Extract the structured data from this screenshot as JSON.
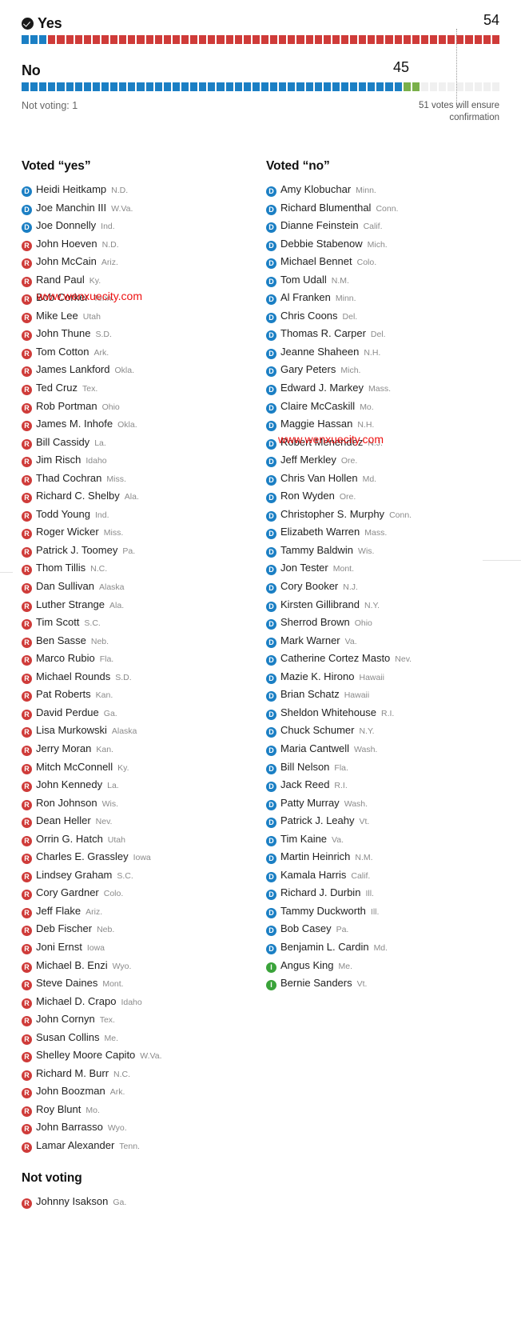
{
  "summary": {
    "yes": {
      "label": "Yes",
      "count": "54",
      "icon": "check-circle-icon",
      "blocks": [
        {
          "party": "D",
          "n": 3
        },
        {
          "party": "R",
          "n": 51
        }
      ]
    },
    "no": {
      "label": "No",
      "count": "45",
      "blocks": [
        {
          "party": "D",
          "n": 43
        },
        {
          "party": "I",
          "n": 2
        },
        {
          "party": "empty",
          "n": 9
        }
      ]
    },
    "not_voting_line": "Not voting: 1",
    "threshold_note": "51 votes will ensure confirmation"
  },
  "colors": {
    "democrat": "#1b7fc4",
    "republican": "#cf3b39",
    "independent": "#7ab04a",
    "empty": "#f0f0f0"
  },
  "watermark": {
    "text": "www.wenxuecity.com"
  },
  "sections": {
    "yes_title": "Voted “yes”",
    "no_title": "Voted “no”",
    "not_voting_title": "Not voting"
  },
  "voted_yes": [
    {
      "party": "D",
      "name": "Heidi Heitkamp",
      "state": "N.D."
    },
    {
      "party": "D",
      "name": "Joe Manchin III",
      "state": "W.Va."
    },
    {
      "party": "D",
      "name": "Joe Donnelly",
      "state": "Ind."
    },
    {
      "party": "R",
      "name": "John Hoeven",
      "state": "N.D."
    },
    {
      "party": "R",
      "name": "John McCain",
      "state": "Ariz."
    },
    {
      "party": "R",
      "name": "Rand Paul",
      "state": "Ky."
    },
    {
      "party": "R",
      "name": "Bob Corker",
      "state": "Tenn."
    },
    {
      "party": "R",
      "name": "Mike Lee",
      "state": "Utah"
    },
    {
      "party": "R",
      "name": "John Thune",
      "state": "S.D."
    },
    {
      "party": "R",
      "name": "Tom Cotton",
      "state": "Ark."
    },
    {
      "party": "R",
      "name": "James Lankford",
      "state": "Okla."
    },
    {
      "party": "R",
      "name": "Ted Cruz",
      "state": "Tex."
    },
    {
      "party": "R",
      "name": "Rob Portman",
      "state": "Ohio"
    },
    {
      "party": "R",
      "name": "James M. Inhofe",
      "state": "Okla."
    },
    {
      "party": "R",
      "name": "Bill Cassidy",
      "state": "La."
    },
    {
      "party": "R",
      "name": "Jim Risch",
      "state": "Idaho"
    },
    {
      "party": "R",
      "name": "Thad Cochran",
      "state": "Miss."
    },
    {
      "party": "R",
      "name": "Richard C. Shelby",
      "state": "Ala."
    },
    {
      "party": "R",
      "name": "Todd Young",
      "state": "Ind."
    },
    {
      "party": "R",
      "name": "Roger Wicker",
      "state": "Miss."
    },
    {
      "party": "R",
      "name": "Patrick J. Toomey",
      "state": "Pa."
    },
    {
      "party": "R",
      "name": "Thom Tillis",
      "state": "N.C."
    },
    {
      "party": "R",
      "name": "Dan Sullivan",
      "state": "Alaska"
    },
    {
      "party": "R",
      "name": "Luther Strange",
      "state": "Ala."
    },
    {
      "party": "R",
      "name": "Tim Scott",
      "state": "S.C."
    },
    {
      "party": "R",
      "name": "Ben Sasse",
      "state": "Neb."
    },
    {
      "party": "R",
      "name": "Marco Rubio",
      "state": "Fla."
    },
    {
      "party": "R",
      "name": "Michael Rounds",
      "state": "S.D."
    },
    {
      "party": "R",
      "name": "Pat Roberts",
      "state": "Kan."
    },
    {
      "party": "R",
      "name": "David Perdue",
      "state": "Ga."
    },
    {
      "party": "R",
      "name": "Lisa Murkowski",
      "state": "Alaska"
    },
    {
      "party": "R",
      "name": "Jerry Moran",
      "state": "Kan."
    },
    {
      "party": "R",
      "name": "Mitch McConnell",
      "state": "Ky."
    },
    {
      "party": "R",
      "name": "John Kennedy",
      "state": "La."
    },
    {
      "party": "R",
      "name": "Ron Johnson",
      "state": "Wis."
    },
    {
      "party": "R",
      "name": "Dean Heller",
      "state": "Nev."
    },
    {
      "party": "R",
      "name": "Orrin G. Hatch",
      "state": "Utah"
    },
    {
      "party": "R",
      "name": "Charles E. Grassley",
      "state": "Iowa"
    },
    {
      "party": "R",
      "name": "Lindsey Graham",
      "state": "S.C."
    },
    {
      "party": "R",
      "name": "Cory Gardner",
      "state": "Colo."
    },
    {
      "party": "R",
      "name": "Jeff Flake",
      "state": "Ariz."
    },
    {
      "party": "R",
      "name": "Deb Fischer",
      "state": "Neb."
    },
    {
      "party": "R",
      "name": "Joni Ernst",
      "state": "Iowa"
    },
    {
      "party": "R",
      "name": "Michael B. Enzi",
      "state": "Wyo."
    },
    {
      "party": "R",
      "name": "Steve Daines",
      "state": "Mont."
    },
    {
      "party": "R",
      "name": "Michael D. Crapo",
      "state": "Idaho"
    },
    {
      "party": "R",
      "name": "John Cornyn",
      "state": "Tex."
    },
    {
      "party": "R",
      "name": "Susan Collins",
      "state": "Me."
    },
    {
      "party": "R",
      "name": "Shelley Moore Capito",
      "state": "W.Va."
    },
    {
      "party": "R",
      "name": "Richard M. Burr",
      "state": "N.C."
    },
    {
      "party": "R",
      "name": "John Boozman",
      "state": "Ark."
    },
    {
      "party": "R",
      "name": "Roy Blunt",
      "state": "Mo."
    },
    {
      "party": "R",
      "name": "John Barrasso",
      "state": "Wyo."
    },
    {
      "party": "R",
      "name": "Lamar Alexander",
      "state": "Tenn."
    }
  ],
  "voted_no": [
    {
      "party": "D",
      "name": "Amy Klobuchar",
      "state": "Minn."
    },
    {
      "party": "D",
      "name": "Richard Blumenthal",
      "state": "Conn."
    },
    {
      "party": "D",
      "name": "Dianne Feinstein",
      "state": "Calif."
    },
    {
      "party": "D",
      "name": "Debbie Stabenow",
      "state": "Mich."
    },
    {
      "party": "D",
      "name": "Michael Bennet",
      "state": "Colo."
    },
    {
      "party": "D",
      "name": "Tom Udall",
      "state": "N.M."
    },
    {
      "party": "D",
      "name": "Al Franken",
      "state": "Minn."
    },
    {
      "party": "D",
      "name": "Chris Coons",
      "state": "Del."
    },
    {
      "party": "D",
      "name": "Thomas R. Carper",
      "state": "Del."
    },
    {
      "party": "D",
      "name": "Jeanne Shaheen",
      "state": "N.H."
    },
    {
      "party": "D",
      "name": "Gary Peters",
      "state": "Mich."
    },
    {
      "party": "D",
      "name": "Edward J. Markey",
      "state": "Mass."
    },
    {
      "party": "D",
      "name": "Claire McCaskill",
      "state": "Mo."
    },
    {
      "party": "D",
      "name": "Maggie Hassan",
      "state": "N.H."
    },
    {
      "party": "D",
      "name": "Robert Menendez",
      "state": "N.J."
    },
    {
      "party": "D",
      "name": "Jeff Merkley",
      "state": "Ore."
    },
    {
      "party": "D",
      "name": "Chris Van Hollen",
      "state": "Md."
    },
    {
      "party": "D",
      "name": "Ron Wyden",
      "state": "Ore."
    },
    {
      "party": "D",
      "name": "Christopher S. Murphy",
      "state": "Conn."
    },
    {
      "party": "D",
      "name": "Elizabeth Warren",
      "state": "Mass."
    },
    {
      "party": "D",
      "name": "Tammy Baldwin",
      "state": "Wis."
    },
    {
      "party": "D",
      "name": "Jon Tester",
      "state": "Mont."
    },
    {
      "party": "D",
      "name": "Cory Booker",
      "state": "N.J."
    },
    {
      "party": "D",
      "name": "Kirsten Gillibrand",
      "state": "N.Y."
    },
    {
      "party": "D",
      "name": "Sherrod Brown",
      "state": "Ohio"
    },
    {
      "party": "D",
      "name": "Mark Warner",
      "state": "Va."
    },
    {
      "party": "D",
      "name": "Catherine Cortez Masto",
      "state": "Nev."
    },
    {
      "party": "D",
      "name": "Mazie K. Hirono",
      "state": "Hawaii"
    },
    {
      "party": "D",
      "name": "Brian Schatz",
      "state": "Hawaii"
    },
    {
      "party": "D",
      "name": "Sheldon Whitehouse",
      "state": "R.I."
    },
    {
      "party": "D",
      "name": "Chuck Schumer",
      "state": "N.Y."
    },
    {
      "party": "D",
      "name": "Maria Cantwell",
      "state": "Wash."
    },
    {
      "party": "D",
      "name": "Bill Nelson",
      "state": "Fla."
    },
    {
      "party": "D",
      "name": "Jack Reed",
      "state": "R.I."
    },
    {
      "party": "D",
      "name": "Patty Murray",
      "state": "Wash."
    },
    {
      "party": "D",
      "name": "Patrick J. Leahy",
      "state": "Vt."
    },
    {
      "party": "D",
      "name": "Tim Kaine",
      "state": "Va."
    },
    {
      "party": "D",
      "name": "Martin Heinrich",
      "state": "N.M."
    },
    {
      "party": "D",
      "name": "Kamala Harris",
      "state": "Calif."
    },
    {
      "party": "D",
      "name": "Richard J. Durbin",
      "state": "Ill."
    },
    {
      "party": "D",
      "name": "Tammy Duckworth",
      "state": "Ill."
    },
    {
      "party": "D",
      "name": "Bob Casey",
      "state": "Pa."
    },
    {
      "party": "D",
      "name": "Benjamin L. Cardin",
      "state": "Md."
    },
    {
      "party": "I",
      "name": "Angus King",
      "state": "Me."
    },
    {
      "party": "I",
      "name": "Bernie Sanders",
      "state": "Vt."
    }
  ],
  "not_voting": [
    {
      "party": "R",
      "name": "Johnny Isakson",
      "state": "Ga."
    }
  ]
}
